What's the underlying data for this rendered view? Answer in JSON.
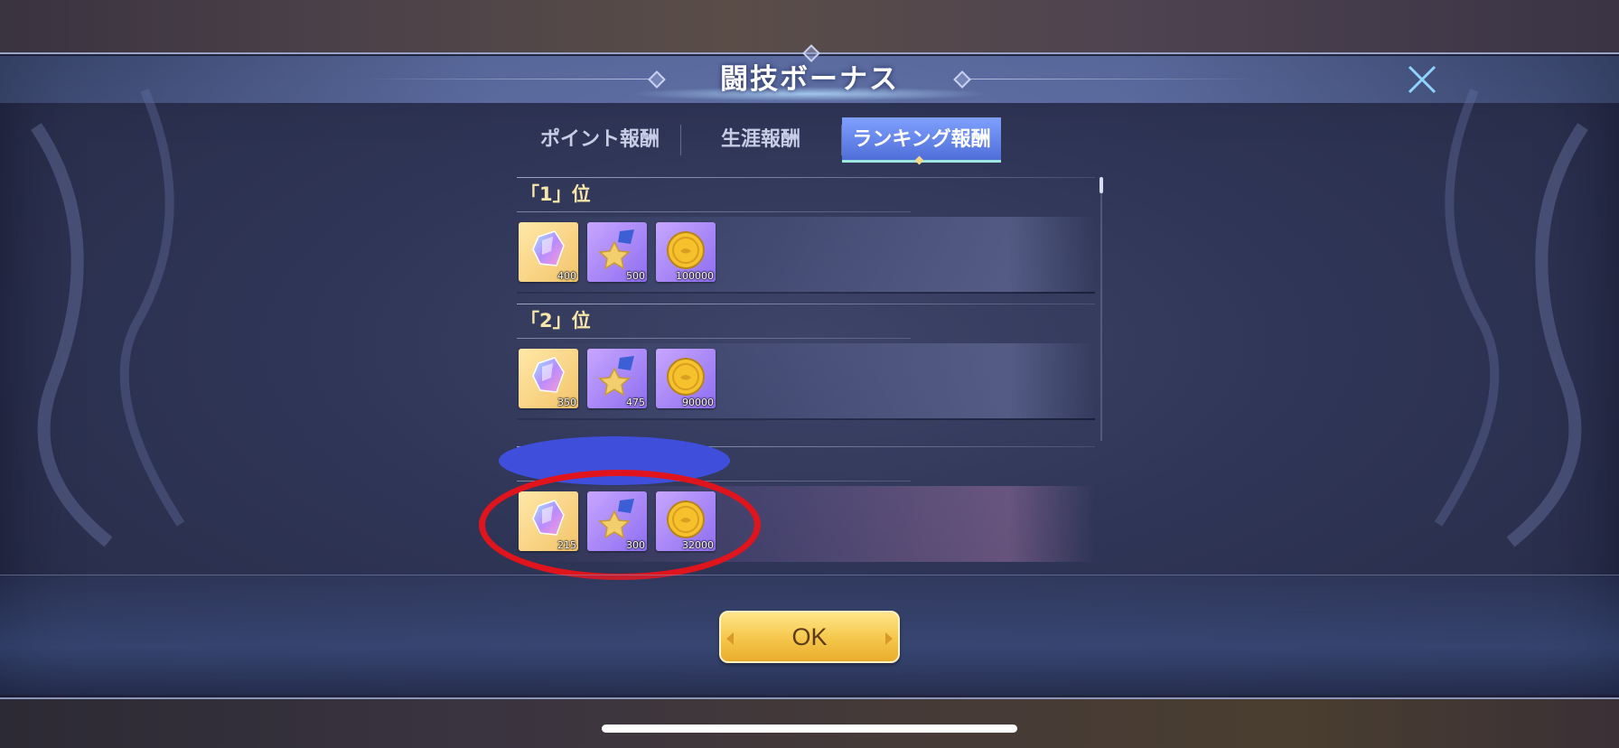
{
  "dialog": {
    "title": "闘技ボーナス",
    "close_icon": "close-icon"
  },
  "tabs": [
    {
      "label": "ポイント報酬",
      "selected": false
    },
    {
      "label": "生涯報酬",
      "selected": false
    },
    {
      "label": "ランキング報酬",
      "selected": true
    }
  ],
  "ranks": [
    {
      "label": "「1」位",
      "rewards": [
        {
          "icon": "crystal-icon",
          "qty": "400"
        },
        {
          "icon": "star-medal-icon",
          "qty": "500"
        },
        {
          "icon": "gold-coin-icon",
          "qty": "100000"
        }
      ]
    },
    {
      "label": "「2」位",
      "rewards": [
        {
          "icon": "crystal-icon",
          "qty": "350"
        },
        {
          "icon": "star-medal-icon",
          "qty": "475"
        },
        {
          "icon": "gold-coin-icon",
          "qty": "90000"
        }
      ]
    },
    {
      "label": "",
      "rewards": [
        {
          "icon": "crystal-icon",
          "qty": "215"
        },
        {
          "icon": "star-medal-icon",
          "qty": "300"
        },
        {
          "icon": "gold-coin-icon",
          "qty": "32000"
        }
      ]
    }
  ],
  "ok_button": {
    "label": "OK"
  },
  "colors": {
    "selected_tab": "#5f7fe8",
    "rank_label": "#f6e6a8",
    "ok_button": "#f6c94e",
    "annotation_circle": "#e0141c",
    "redaction_blob": "#3f4fdc"
  }
}
